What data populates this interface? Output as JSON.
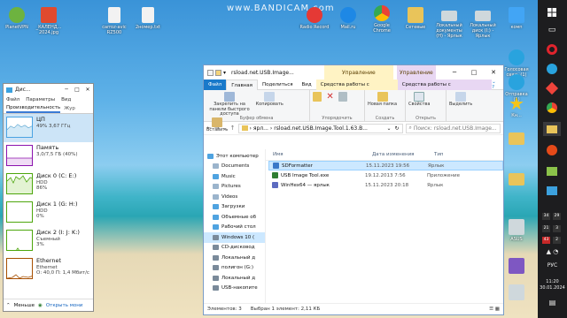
{
  "watermark": "www.BANDICAM.com",
  "desktop_icons": [
    {
      "label": "PlanetVPN",
      "icon": "vpn-icon",
      "color": "#6db33f"
    },
    {
      "label": "_КАЛЕНД... 2024.jpg",
      "icon": "image-file-icon",
      "color": "#e04a2f"
    },
    {
      "label": "carroz-avic RZ500",
      "icon": "text-file-icon",
      "color": "#f2f2f2"
    },
    {
      "label": "2номер.txt",
      "icon": "text-file-icon",
      "color": "#f2f2f2"
    },
    {
      "label": "Radio Record",
      "icon": "radio-icon",
      "color": "#e53935"
    },
    {
      "label": "Mail.ru",
      "icon": "mail-icon",
      "color": "#1e88e5"
    },
    {
      "label": "Google Chrome",
      "icon": "chrome-icon",
      "color": "#34a853"
    },
    {
      "label": "Сетевые",
      "icon": "network-icon",
      "color": "#e9c45a"
    },
    {
      "label": "Локальный документы (H) - Ярлык",
      "icon": "drive-icon",
      "color": "#cfd8dc"
    },
    {
      "label": "Локальный диск (I:) - Ярлык",
      "icon": "drive-icon",
      "color": "#cfd8dc"
    },
    {
      "label": "комп",
      "icon": "computer-icon",
      "color": "#42a5f5"
    },
    {
      "label": "Голосовая связь (1)",
      "icon": "telegram-icon",
      "color": "#29a3de"
    },
    {
      "label": "Отправка (1)",
      "icon": "telegram-icon",
      "color": "#29a3de"
    },
    {
      "label": "Кн...",
      "icon": "star-icon",
      "color": "#f5c518"
    },
    {
      "label": "",
      "icon": "folder-icon",
      "color": "#e9c45a"
    },
    {
      "label": "",
      "icon": "folder-icon",
      "color": "#e9c45a"
    },
    {
      "label": "ASUS",
      "icon": "app-icon",
      "color": "#cfd8dc"
    },
    {
      "label": "",
      "icon": "app-icon",
      "color": "#7e57c2"
    },
    {
      "label": "",
      "icon": "app-icon",
      "color": "#cfd8dc"
    }
  ],
  "taskbar": {
    "lang": "РУС",
    "time": "11:20",
    "date": "30.01.2024",
    "tray_numbers": [
      "34",
      "29",
      "21",
      "3",
      "43",
      "2"
    ]
  },
  "task_manager": {
    "title": "Дис...",
    "menu": [
      "Файл",
      "Параметры",
      "Вид"
    ],
    "tab_active": "Производительность",
    "tab_next": "Жур",
    "rows": [
      {
        "name": "ЦП",
        "line1": "49%  3,67 ГГц",
        "line2": "",
        "line3": ""
      },
      {
        "name": "Память",
        "line1": "3,0/7,5 ГБ (40%)",
        "line2": "",
        "line3": ""
      },
      {
        "name": "Диск 0 (C: E:)",
        "line1": "HDD",
        "line2": "86%",
        "line3": ""
      },
      {
        "name": "Диск 1 (G: H:)",
        "line1": "HDD",
        "line2": "0%",
        "line3": ""
      },
      {
        "name": "Диск 2 (I: J: K:)",
        "line1": "Съемный",
        "line2": "3%",
        "line3": ""
      },
      {
        "name": "Ethernet",
        "line1": "Ethernet",
        "line2": "О: 40,0  П: 1,4 Мбит/с",
        "line3": ""
      }
    ],
    "footer_less": "Меньше",
    "footer_link": "Открыть мони"
  },
  "explorer": {
    "title": "rsload.net.USB.Image...",
    "ctx_tab1": "Управление",
    "ctx_tab2": "Управление",
    "ribbon_tabs": [
      "Файл",
      "Главная",
      "Поделиться",
      "Вид",
      "Средства работы с ярлыками",
      "Средства работы с приложениями"
    ],
    "ribbon": {
      "pin": "Закрепить на панели быстрого доступа",
      "copy": "Копировать",
      "paste": "Вставить",
      "group_clipboard": "Буфер обмена",
      "group_organize": "Упорядочить",
      "new_folder": "Новая папка",
      "group_create": "Создать",
      "properties": "Свойства",
      "group_open": "Открыть",
      "select": "Выделить"
    },
    "address": {
      "segment1": "ярл...",
      "segment2": "rsload.net.USB.Image.Tool.1.63.B...",
      "search_placeholder": "Поиск: rsload.net.USB.Image..."
    },
    "nav": [
      {
        "label": "Этот компьютер",
        "icon": "computer-icon",
        "color": "#4fa3e0"
      },
      {
        "label": "Documents",
        "icon": "documents-icon",
        "color": "#9bb4cc"
      },
      {
        "label": "Music",
        "icon": "music-icon",
        "color": "#4fa3e0"
      },
      {
        "label": "Pictures",
        "icon": "pictures-icon",
        "color": "#9bb4cc"
      },
      {
        "label": "Videos",
        "icon": "videos-icon",
        "color": "#9bb4cc"
      },
      {
        "label": "Загрузки",
        "icon": "downloads-icon",
        "color": "#4fa3e0"
      },
      {
        "label": "Объемные об",
        "icon": "3d-objects-icon",
        "color": "#4fa3e0"
      },
      {
        "label": "Рабочий стол",
        "icon": "desktop-icon",
        "color": "#4fa3e0"
      },
      {
        "label": "Windows 10 (",
        "icon": "windows-drive-icon",
        "color": "#7a8a9a"
      },
      {
        "label": "CD-дисковод",
        "icon": "cd-drive-icon",
        "color": "#7a8a9a"
      },
      {
        "label": "Локальный д",
        "icon": "drive-icon",
        "color": "#7a8a9a"
      },
      {
        "label": "полигон (G:)",
        "icon": "drive-icon",
        "color": "#7a8a9a"
      },
      {
        "label": "Локальный д",
        "icon": "drive-icon",
        "color": "#7a8a9a"
      },
      {
        "label": "USB-накопите",
        "icon": "usb-drive-icon",
        "color": "#7a8a9a"
      }
    ],
    "columns": [
      "Имя",
      "Дата изменения",
      "Тип"
    ],
    "files": [
      {
        "name": "SDFormatter",
        "date": "15.11.2023 19:56",
        "type": "Ярлык",
        "icon": "shortcut-icon",
        "color": "#3a78c8",
        "selected": true
      },
      {
        "name": "USB Image Tool.exe",
        "date": "19.12.2013 7:56",
        "type": "Приложение",
        "icon": "app-exe-icon",
        "color": "#2e7d32",
        "selected": false
      },
      {
        "name": "WinHex64 — ярлык",
        "date": "15.11.2023 20:18",
        "type": "Ярлык",
        "icon": "shortcut-icon",
        "color": "#5c6bc0",
        "selected": false
      }
    ],
    "status": {
      "count": "Элементов: 3",
      "selected": "Выбран 1 элемент: 2,11 КБ"
    }
  }
}
